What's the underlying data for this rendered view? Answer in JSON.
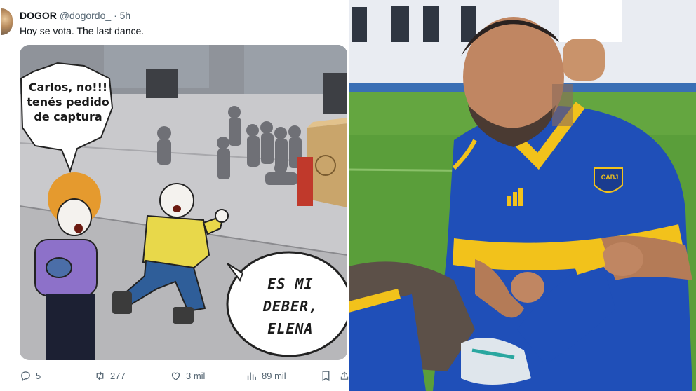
{
  "tweet": {
    "author_name": "DOGOR",
    "author_handle": "@dogordo_",
    "separator": "·",
    "time": "5h",
    "text": "Hoy se vota. The last dance.",
    "meme": {
      "bubble_left_lines": [
        "Carlos, no!!!",
        "tenés pedido",
        "de captura"
      ],
      "bubble_right_lines": [
        "ES MI",
        "DEBER,",
        "ELENA"
      ]
    },
    "actions": {
      "replies": "5",
      "retweets": "277",
      "likes": "3 mil",
      "views": "89 mil"
    }
  },
  "photo": {
    "jersey_crest_text": "CABJ",
    "colors": {
      "jersey_blue": "#1f4fb8",
      "jersey_yellow": "#f2c21b",
      "grass": "#5a9e3a",
      "stand": "#e9ecf2"
    }
  },
  "icons": [
    "reply-icon",
    "retweet-icon",
    "like-icon",
    "views-icon",
    "bookmark-icon",
    "share-icon"
  ]
}
